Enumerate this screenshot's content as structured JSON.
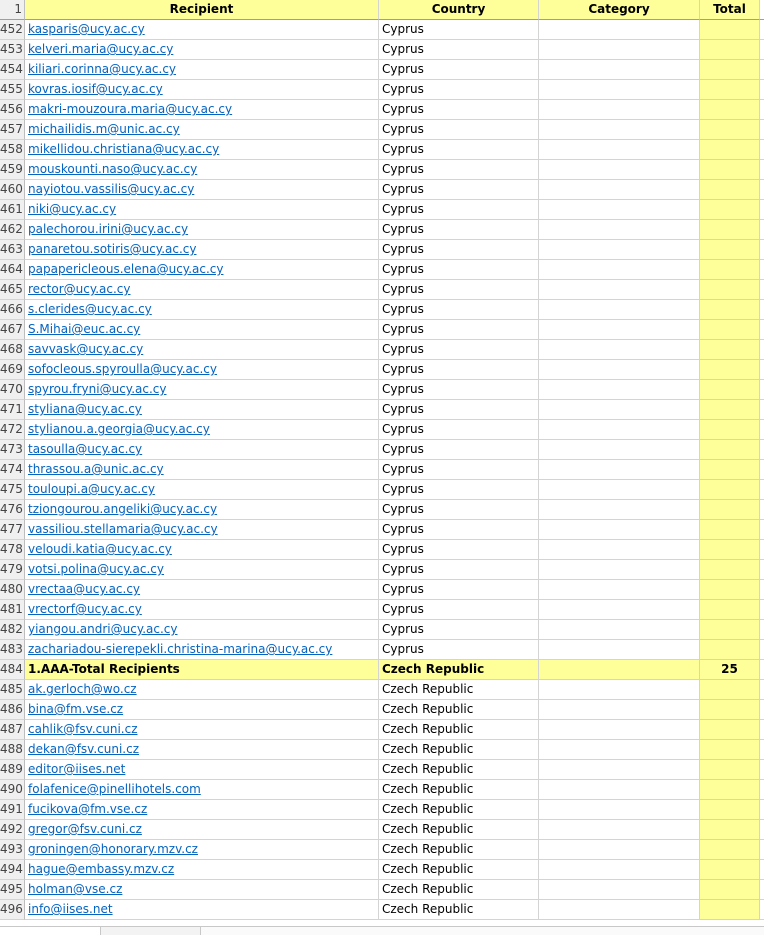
{
  "header": {
    "row_number": "1",
    "col_recipient": "Recipient",
    "col_country": "Country",
    "col_category": "Category",
    "col_total": "Total"
  },
  "rows": [
    {
      "n": "452",
      "recipient": "kasparis@ucy.ac.cy",
      "country": "Cyprus",
      "category": "",
      "total": "",
      "kind": "link"
    },
    {
      "n": "453",
      "recipient": "kelveri.maria@ucy.ac.cy",
      "country": "Cyprus",
      "category": "",
      "total": "",
      "kind": "link"
    },
    {
      "n": "454",
      "recipient": "kiliari.corinna@ucy.ac.cy",
      "country": "Cyprus",
      "category": "",
      "total": "",
      "kind": "link"
    },
    {
      "n": "455",
      "recipient": "kovras.iosif@ucy.ac.cy",
      "country": "Cyprus",
      "category": "",
      "total": "",
      "kind": "link"
    },
    {
      "n": "456",
      "recipient": "makri-mouzoura.maria@ucy.ac.cy",
      "country": "Cyprus",
      "category": "",
      "total": "",
      "kind": "link"
    },
    {
      "n": "457",
      "recipient": "michailidis.m@unic.ac.cy",
      "country": "Cyprus",
      "category": "",
      "total": "",
      "kind": "link"
    },
    {
      "n": "458",
      "recipient": "mikellidou.christiana@ucy.ac.cy",
      "country": "Cyprus",
      "category": "",
      "total": "",
      "kind": "link"
    },
    {
      "n": "459",
      "recipient": "mouskounti.naso@ucy.ac.cy",
      "country": "Cyprus",
      "category": "",
      "total": "",
      "kind": "link"
    },
    {
      "n": "460",
      "recipient": "nayiotou.vassilis@ucy.ac.cy",
      "country": "Cyprus",
      "category": "",
      "total": "",
      "kind": "link"
    },
    {
      "n": "461",
      "recipient": "niki@ucy.ac.cy",
      "country": "Cyprus",
      "category": "",
      "total": "",
      "kind": "link"
    },
    {
      "n": "462",
      "recipient": "palechorou.irini@ucy.ac.cy",
      "country": "Cyprus",
      "category": "",
      "total": "",
      "kind": "link"
    },
    {
      "n": "463",
      "recipient": "panaretou.sotiris@ucy.ac.cy",
      "country": "Cyprus",
      "category": "",
      "total": "",
      "kind": "link"
    },
    {
      "n": "464",
      "recipient": "papapericleous.elena@ucy.ac.cy",
      "country": "Cyprus",
      "category": "",
      "total": "",
      "kind": "link"
    },
    {
      "n": "465",
      "recipient": "rector@ucy.ac.cy",
      "country": "Cyprus",
      "category": "",
      "total": "",
      "kind": "link"
    },
    {
      "n": "466",
      "recipient": "s.clerides@ucy.ac.cy",
      "country": "Cyprus",
      "category": "",
      "total": "",
      "kind": "link"
    },
    {
      "n": "467",
      "recipient": "S.Mihai@euc.ac.cy",
      "country": "Cyprus",
      "category": "",
      "total": "",
      "kind": "link"
    },
    {
      "n": "468",
      "recipient": "savvask@ucy.ac.cy",
      "country": "Cyprus",
      "category": "",
      "total": "",
      "kind": "link"
    },
    {
      "n": "469",
      "recipient": "sofocleous.spyroulla@ucy.ac.cy",
      "country": "Cyprus",
      "category": "",
      "total": "",
      "kind": "link"
    },
    {
      "n": "470",
      "recipient": "spyrou.fryni@ucy.ac.cy",
      "country": "Cyprus",
      "category": "",
      "total": "",
      "kind": "link"
    },
    {
      "n": "471",
      "recipient": "styliana@ucy.ac.cy",
      "country": "Cyprus",
      "category": "",
      "total": "",
      "kind": "link"
    },
    {
      "n": "472",
      "recipient": "stylianou.a.georgia@ucy.ac.cy",
      "country": "Cyprus",
      "category": "",
      "total": "",
      "kind": "link"
    },
    {
      "n": "473",
      "recipient": "tasoulla@ucy.ac.cy",
      "country": "Cyprus",
      "category": "",
      "total": "",
      "kind": "link"
    },
    {
      "n": "474",
      "recipient": "thrassou.a@unic.ac.cy",
      "country": "Cyprus",
      "category": "",
      "total": "",
      "kind": "link"
    },
    {
      "n": "475",
      "recipient": "touloupi.a@ucy.ac.cy",
      "country": "Cyprus",
      "category": "",
      "total": "",
      "kind": "link"
    },
    {
      "n": "476",
      "recipient": "tziongourou.angeliki@ucy.ac.cy",
      "country": "Cyprus",
      "category": "",
      "total": "",
      "kind": "link"
    },
    {
      "n": "477",
      "recipient": "vassiliou.stellamaria@ucy.ac.cy",
      "country": "Cyprus",
      "category": "",
      "total": "",
      "kind": "link"
    },
    {
      "n": "478",
      "recipient": "veloudi.katia@ucy.ac.cy",
      "country": "Cyprus",
      "category": "",
      "total": "",
      "kind": "link"
    },
    {
      "n": "479",
      "recipient": "votsi.polina@ucy.ac.cy",
      "country": "Cyprus",
      "category": "",
      "total": "",
      "kind": "link"
    },
    {
      "n": "480",
      "recipient": "vrectaa@ucy.ac.cy",
      "country": "Cyprus",
      "category": "",
      "total": "",
      "kind": "link"
    },
    {
      "n": "481",
      "recipient": "vrectorf@ucy.ac.cy",
      "country": "Cyprus",
      "category": "",
      "total": "",
      "kind": "link"
    },
    {
      "n": "482",
      "recipient": "yiangou.andri@ucy.ac.cy",
      "country": "Cyprus",
      "category": "",
      "total": "",
      "kind": "link"
    },
    {
      "n": "483",
      "recipient": "zachariadou-sierepekli.christina-marina@ucy.ac.cy",
      "country": "Cyprus",
      "category": "",
      "total": "",
      "kind": "link"
    },
    {
      "n": "484",
      "recipient": "1.AAA-Total Recipients",
      "country": "Czech Republic",
      "category": "",
      "total": "25",
      "kind": "total"
    },
    {
      "n": "485",
      "recipient": "ak.gerloch@wo.cz",
      "country": "Czech Republic",
      "category": "",
      "total": "",
      "kind": "link"
    },
    {
      "n": "486",
      "recipient": "bina@fm.vse.cz",
      "country": "Czech Republic",
      "category": "",
      "total": "",
      "kind": "link"
    },
    {
      "n": "487",
      "recipient": "cahlik@fsv.cuni.cz",
      "country": "Czech Republic",
      "category": "",
      "total": "",
      "kind": "link"
    },
    {
      "n": "488",
      "recipient": "dekan@fsv.cuni.cz",
      "country": "Czech Republic",
      "category": "",
      "total": "",
      "kind": "link"
    },
    {
      "n": "489",
      "recipient": "editor@iises.net",
      "country": "Czech Republic",
      "category": "",
      "total": "",
      "kind": "link"
    },
    {
      "n": "490",
      "recipient": "folafenice@pinellihotels.com",
      "country": "Czech Republic",
      "category": "",
      "total": "",
      "kind": "link"
    },
    {
      "n": "491",
      "recipient": "fucikova@fm.vse.cz",
      "country": "Czech Republic",
      "category": "",
      "total": "",
      "kind": "link"
    },
    {
      "n": "492",
      "recipient": "gregor@fsv.cuni.cz",
      "country": "Czech Republic",
      "category": "",
      "total": "",
      "kind": "link"
    },
    {
      "n": "493",
      "recipient": "groningen@honorary.mzv.cz",
      "country": "Czech Republic",
      "category": "",
      "total": "",
      "kind": "link"
    },
    {
      "n": "494",
      "recipient": "hague@embassy.mzv.cz",
      "country": "Czech Republic",
      "category": "",
      "total": "",
      "kind": "link"
    },
    {
      "n": "495",
      "recipient": "holman@vse.cz",
      "country": "Czech Republic",
      "category": "",
      "total": "",
      "kind": "link"
    },
    {
      "n": "496",
      "recipient": "info@iises.net",
      "country": "Czech Republic",
      "category": "",
      "total": "",
      "kind": "link"
    }
  ]
}
